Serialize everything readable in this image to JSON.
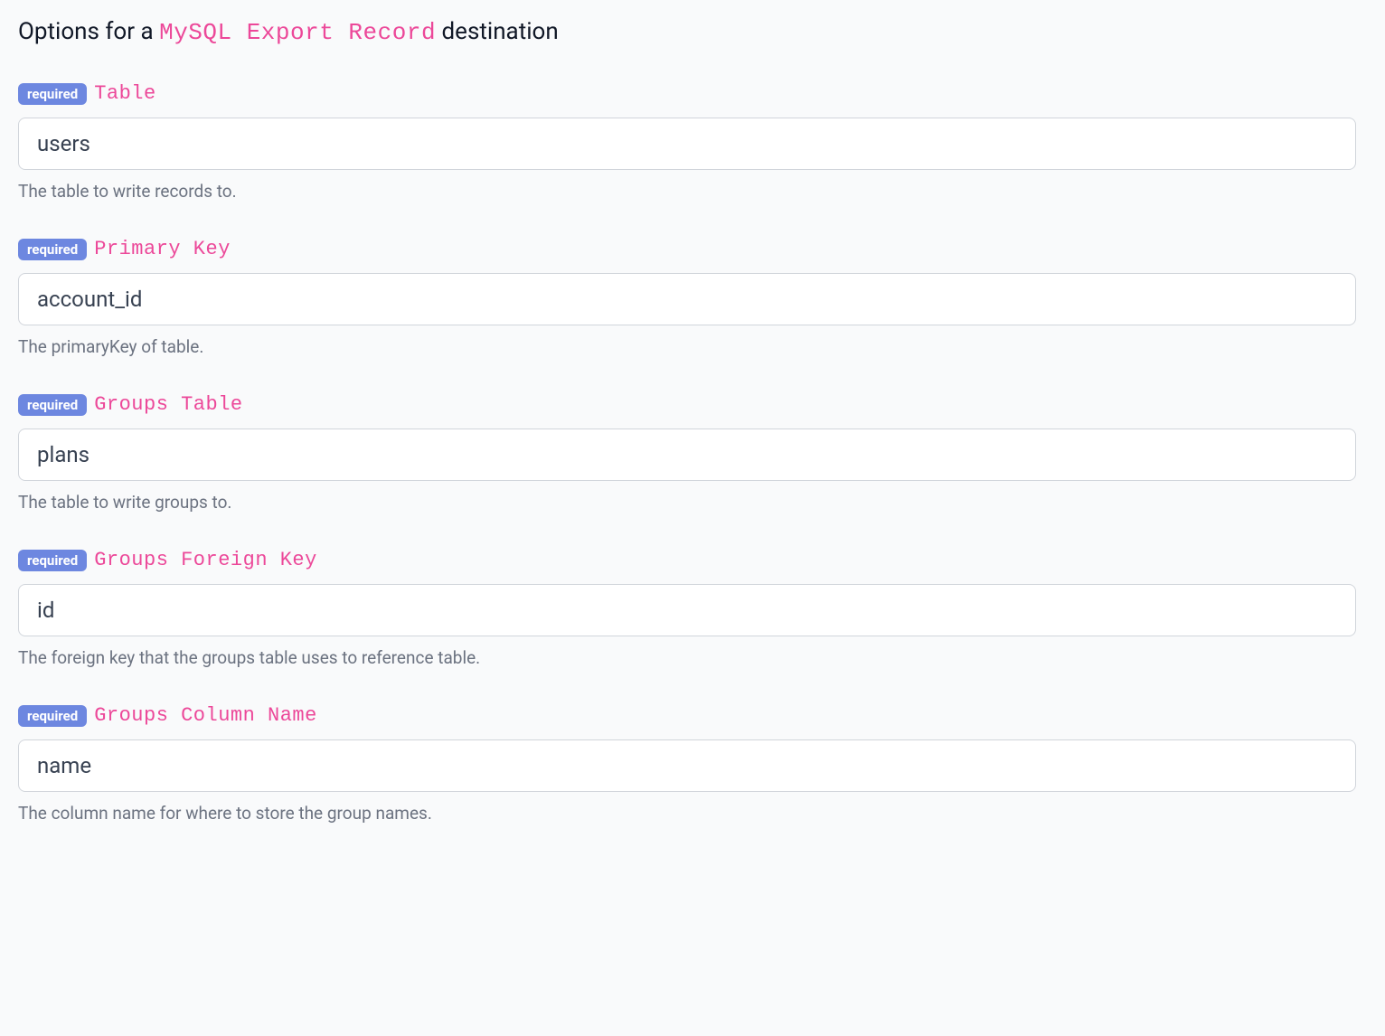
{
  "header": {
    "title_prefix": "Options for a ",
    "title_code": "MySQL Export Record",
    "title_suffix": " destination"
  },
  "badge_text": "required",
  "fields": {
    "table": {
      "label": "Table",
      "value": "users",
      "help": "The table to write records to."
    },
    "primary_key": {
      "label": "Primary Key",
      "value": "account_id",
      "help": "The primaryKey of table."
    },
    "groups_table": {
      "label": "Groups Table",
      "value": "plans",
      "help": "The table to write groups to."
    },
    "groups_foreign_key": {
      "label": "Groups Foreign Key",
      "value": "id",
      "help": "The foreign key that the groups table uses to reference table."
    },
    "groups_column_name": {
      "label": "Groups Column Name",
      "value": "name",
      "help": "The column name for where to store the group names."
    }
  }
}
